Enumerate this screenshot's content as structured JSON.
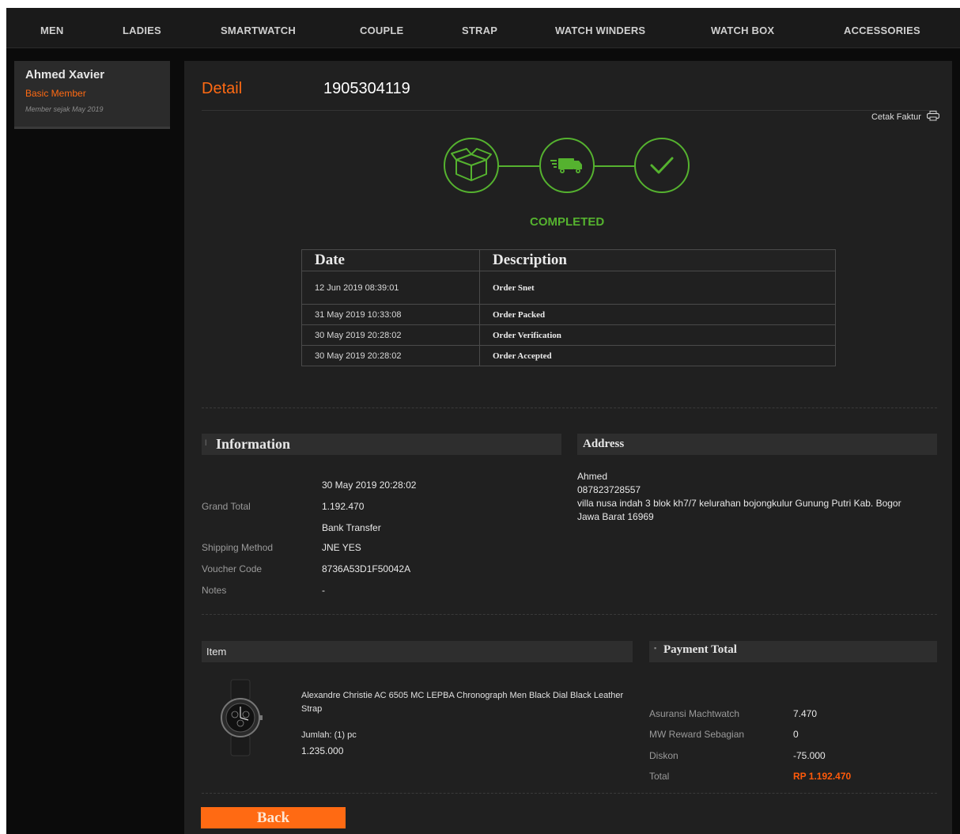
{
  "nav": {
    "items": [
      {
        "label": "MEN"
      },
      {
        "label": "LADIES"
      },
      {
        "label": "SMARTWATCH"
      },
      {
        "label": "COUPLE"
      },
      {
        "label": "STRAP"
      },
      {
        "label": "WATCH WINDERS"
      },
      {
        "label": "WATCH BOX"
      },
      {
        "label": "ACCESSORIES"
      }
    ]
  },
  "sidebar": {
    "name": "Ahmed Xavier",
    "tier": "Basic Member",
    "member_since": "Member sejak May 2019"
  },
  "detail": {
    "label": "Detail",
    "order_number": "1905304119",
    "print_label": "Cetak Faktur"
  },
  "tracker": {
    "status": "COMPLETED",
    "steps": [
      "box-icon",
      "truck-icon",
      "checkmark-icon"
    ],
    "accent_color": "#55b22f"
  },
  "history": {
    "headers": {
      "date": "Date",
      "description": "Description"
    },
    "rows": [
      {
        "date": "12 Jun 2019 08:39:01",
        "description": "Order Snet"
      },
      {
        "date": "31 May 2019 10:33:08",
        "description": "Order Packed"
      },
      {
        "date": "30 May 2019 20:28:02",
        "description": "Order Verification"
      },
      {
        "date": "30 May 2019 20:28:02",
        "description": "Order Accepted"
      }
    ]
  },
  "information": {
    "title": "Information",
    "rows": [
      {
        "key": "",
        "value": "30 May 2019 20:28:02"
      },
      {
        "key": "Grand Total",
        "value": "1.192.470"
      },
      {
        "key": "",
        "value": "Bank Transfer"
      },
      {
        "key": "Shipping Method",
        "value": "JNE YES"
      },
      {
        "key": "Voucher Code",
        "value": "8736A53D1F50042A"
      },
      {
        "key": "Notes",
        "value": "-"
      }
    ]
  },
  "address": {
    "title": "Address",
    "name": "Ahmed",
    "phone": "087823728557",
    "line1": "villa nusa indah 3 blok kh7/7 kelurahan bojongkulur Gunung Putri Kab. Bogor",
    "line2": "Jawa Barat 16969"
  },
  "item": {
    "title": "Item",
    "name": "Alexandre Christie AC 6505 MC LEPBA Chronograph Men Black Dial Black Leather Strap",
    "quantity": "Jumlah: (1) pc",
    "price": "1.235.000"
  },
  "payment": {
    "title": "Payment Total",
    "rows": [
      {
        "key": "Asuransi Machtwatch",
        "value": "7.470"
      },
      {
        "key": "MW Reward Sebagian",
        "value": "0"
      },
      {
        "key": "Diskon",
        "value": "-75.000"
      },
      {
        "key": "Total",
        "value": "RP 1.192.470"
      }
    ],
    "total_color": "#ff5a0a"
  },
  "actions": {
    "back_label": "Back",
    "button_color": "#ff6a13"
  }
}
